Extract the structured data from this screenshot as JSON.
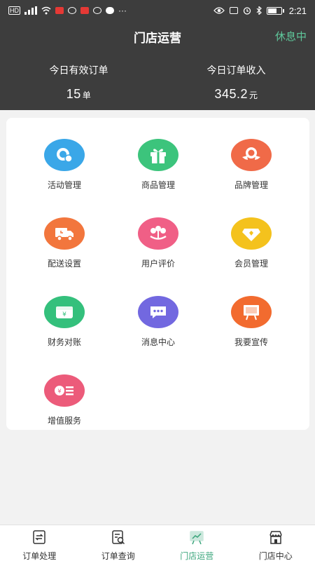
{
  "status_bar": {
    "time": "2:21",
    "left_icons": [
      "hd-icon",
      "signal-icon",
      "wifi-icon",
      "app-icon",
      "app-icon",
      "app-icon",
      "message-icon",
      "more-icon"
    ],
    "right_icons": [
      "eye-icon",
      "nfc-icon",
      "alarm-icon",
      "bluetooth-icon",
      "battery-icon"
    ],
    "hd_label": "HD",
    "more_label": "···"
  },
  "header": {
    "title": "门店运营",
    "status_text": "休息中",
    "stats": {
      "orders_label": "今日有效订单",
      "orders_value": "15",
      "orders_unit": "单",
      "revenue_label": "今日订单收入",
      "revenue_value": "345.2",
      "revenue_unit": "元"
    }
  },
  "grid": [
    {
      "label": "活动管理",
      "icon": "activity-icon",
      "color": "#3aa7e8"
    },
    {
      "label": "商品管理",
      "icon": "gift-icon",
      "color": "#3cc47c"
    },
    {
      "label": "品牌管理",
      "icon": "ribbon-badge-icon",
      "color": "#f06a48"
    },
    {
      "label": "配送设置",
      "icon": "delivery-truck-icon",
      "color": "#f2763d"
    },
    {
      "label": "用户评价",
      "icon": "flower-review-icon",
      "color": "#f05f86"
    },
    {
      "label": "会员管理",
      "icon": "diamond-member-icon",
      "color": "#f4c21d"
    },
    {
      "label": "财务对账",
      "icon": "money-box-icon",
      "color": "#34c07c"
    },
    {
      "label": "消息中心",
      "icon": "chat-bubble-icon",
      "color": "#7268e0"
    },
    {
      "label": "我要宣传",
      "icon": "billboard-icon",
      "color": "#f26b2f"
    },
    {
      "label": "增值服务",
      "icon": "coin-lines-icon",
      "color": "#ec5b7a"
    }
  ],
  "tabs": [
    {
      "label": "订单处理",
      "icon": "order-process-icon"
    },
    {
      "label": "订单查询",
      "icon": "order-search-icon"
    },
    {
      "label": "门店运营",
      "icon": "store-operation-icon",
      "active": true
    },
    {
      "label": "门店中心",
      "icon": "store-center-icon"
    }
  ],
  "colors": {
    "header_bg": "#3d3d3d",
    "accent_green": "#3aa57b",
    "rest_green": "#5fc89b"
  }
}
